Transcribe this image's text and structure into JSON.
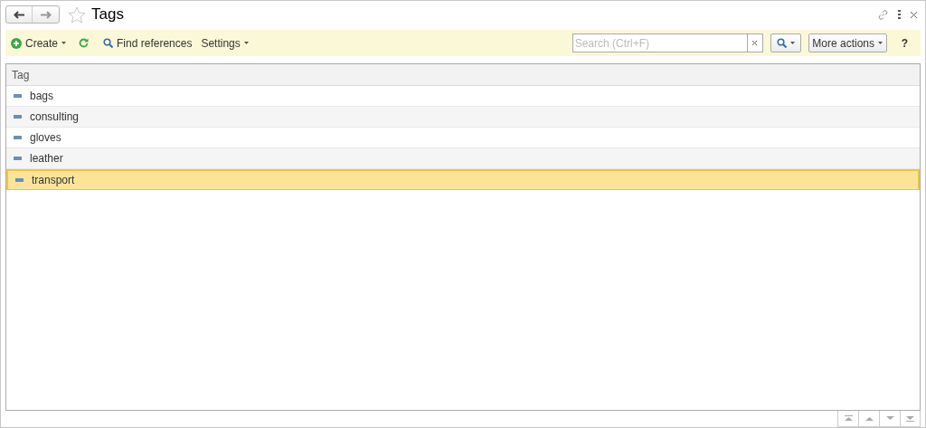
{
  "window": {
    "title": "Tags",
    "favorite": false
  },
  "toolbar": {
    "create": "Create",
    "find_references": "Find references",
    "settings": "Settings",
    "search": {
      "placeholder": "Search (Ctrl+F)"
    },
    "more_actions": "More actions",
    "help": "?"
  },
  "table": {
    "columns": [
      "Tag"
    ],
    "rows": [
      {
        "tag": "bags",
        "selected": false
      },
      {
        "tag": "consulting",
        "selected": false
      },
      {
        "tag": "gloves",
        "selected": false
      },
      {
        "tag": "leather",
        "selected": false
      },
      {
        "tag": "transport",
        "selected": true
      }
    ]
  }
}
